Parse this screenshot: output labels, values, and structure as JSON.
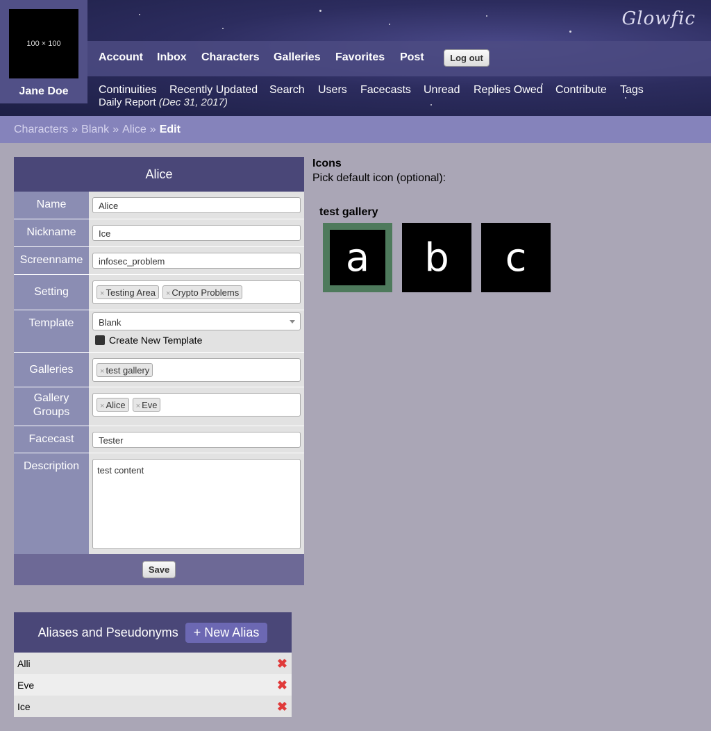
{
  "user": {
    "avatar_text": "100 × 100",
    "name": "Jane Doe"
  },
  "logo": "Glowfic",
  "nav": [
    "Account",
    "Inbox",
    "Characters",
    "Galleries",
    "Favorites",
    "Post"
  ],
  "logout_label": "Log out",
  "subnav": [
    "Continuities",
    "Recently Updated",
    "Search",
    "Users",
    "Facecasts",
    "Unread",
    "Replies Owed",
    "Contribute",
    "Tags"
  ],
  "daily_report": {
    "label": "Daily Report",
    "date": "(Dec 31, 2017)"
  },
  "breadcrumb": {
    "items": [
      "Characters",
      "Blank",
      "Alice"
    ],
    "current": "Edit",
    "separator": "»"
  },
  "form": {
    "title": "Alice",
    "labels": {
      "name": "Name",
      "nickname": "Nickname",
      "screenname": "Screenname",
      "setting": "Setting",
      "template": "Template",
      "galleries": "Galleries",
      "gallery_groups": "Gallery Groups",
      "facecast": "Facecast",
      "description": "Description"
    },
    "name": "Alice",
    "nickname": "Ice",
    "screenname": "infosec_problem",
    "settings": [
      "Testing Area",
      "Crypto Problems"
    ],
    "template": "Blank",
    "create_template_label": "Create New Template",
    "galleries": [
      "test gallery"
    ],
    "gallery_groups": [
      "Alice",
      "Eve"
    ],
    "facecast": "Tester",
    "description": "test content",
    "save_label": "Save"
  },
  "aliases": {
    "title": "Aliases and Pseudonyms",
    "new_label": "+ New Alias",
    "items": [
      "Alli",
      "Eve",
      "Ice"
    ]
  },
  "icons": {
    "title": "Icons",
    "subtitle": "Pick default icon (optional):",
    "gallery_name": "test gallery",
    "tiles": [
      "a",
      "b",
      "c"
    ],
    "selected_index": 0
  },
  "colors": {
    "header": "#2c2c5e",
    "breadcrumb": "#8583bb",
    "form_header": "#4a4778",
    "label_col": "#8b8db3",
    "selected_icon": "#4e7a5c",
    "delete": "#e03a3a"
  }
}
